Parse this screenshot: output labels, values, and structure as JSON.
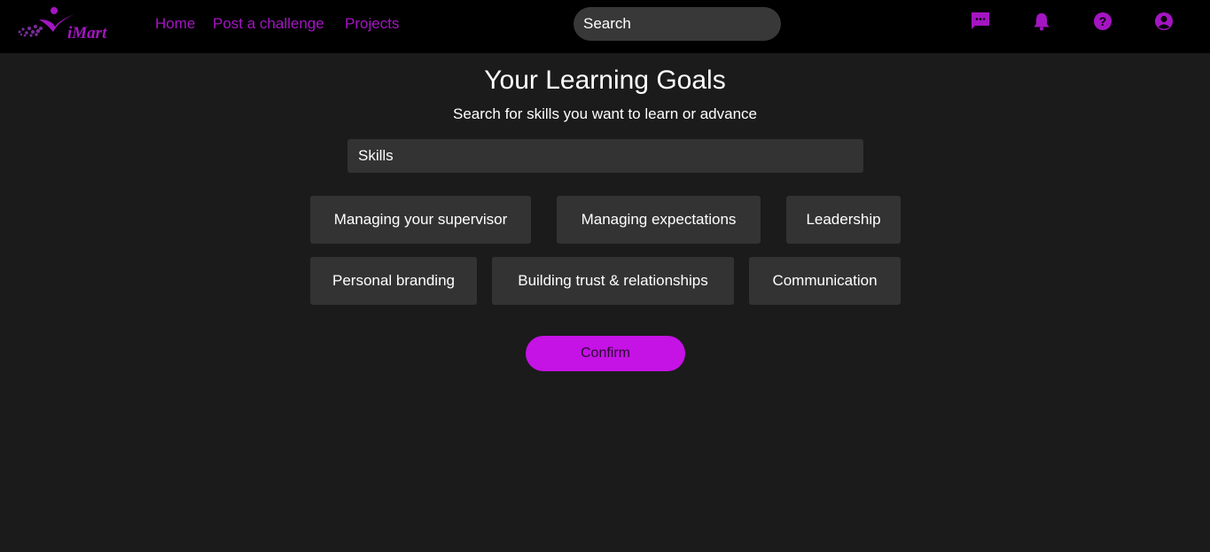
{
  "brand": {
    "logo_text": "iMart"
  },
  "colors": {
    "accent": "#a415c2",
    "button": "#c512e5",
    "background": "#1b1b1b",
    "topbar": "#000000",
    "chip": "#333333"
  },
  "nav": {
    "items": [
      {
        "label": "Home"
      },
      {
        "label": "Post a challenge"
      },
      {
        "label": "Projects"
      }
    ]
  },
  "search": {
    "placeholder": "Search"
  },
  "top_icons": [
    "chat-icon",
    "bell-icon",
    "help-icon",
    "account-icon"
  ],
  "main": {
    "title": "Your Learning Goals",
    "subtitle": "Search for skills you want to learn or advance",
    "skills_placeholder": "Skills",
    "skills": [
      {
        "label": "Managing your supervisor"
      },
      {
        "label": "Managing expectations"
      },
      {
        "label": "Leadership"
      },
      {
        "label": "Personal branding"
      },
      {
        "label": "Building trust & relationships"
      },
      {
        "label": "Communication"
      }
    ],
    "confirm_label": "Confirm"
  }
}
